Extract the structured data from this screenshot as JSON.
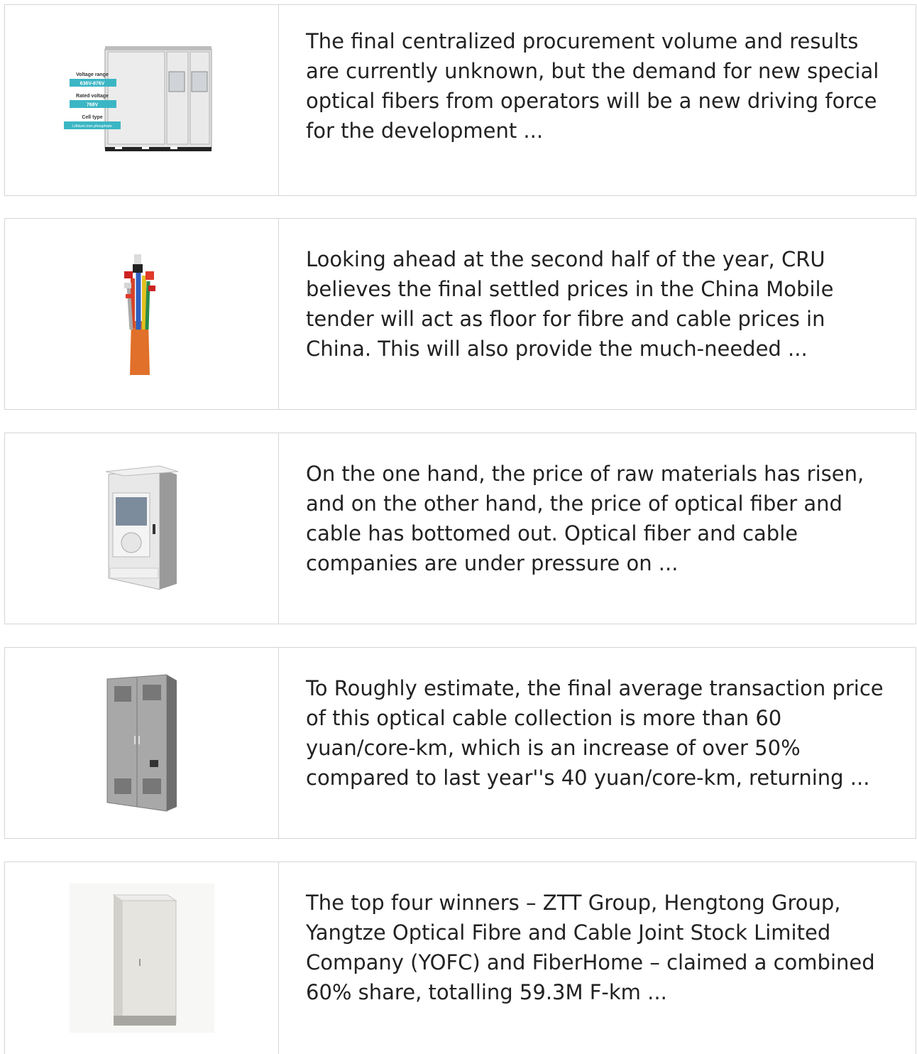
{
  "articles": [
    {
      "image_icon": "battery-cabinet-image",
      "image_labels": [
        "Voltage range",
        "636V-876V",
        "Rated voltage",
        "768V",
        "Cell type",
        "Lithium iron phosphate"
      ],
      "excerpt": "The final centralized procurement volume and results are currently unknown, but the demand for new special optical fibers from operators will be a new driving force for the development ..."
    },
    {
      "image_icon": "cable-bundle-image",
      "excerpt": "Looking ahead at the second half of the year, CRU believes the final settled prices in the China Mobile tender will act as floor for fibre and cable prices in China. This will also provide the much-needed ..."
    },
    {
      "image_icon": "outdoor-cabinet-with-ac-image",
      "excerpt": "On the one hand, the price of raw materials has risen, and on the other hand, the price of optical fiber and cable has bottomed out. Optical fiber and cable companies are under pressure on ..."
    },
    {
      "image_icon": "double-door-cabinet-image",
      "excerpt": "To Roughly estimate, the final average transaction price of this optical cable collection is more than 60 yuan/core-km, which is an increase of over 50% compared to last year''s 40 yuan/core-km, returning ..."
    },
    {
      "image_icon": "single-door-cabinet-image",
      "excerpt": "The top four winners – ZTT Group, Hengtong Group, Yangtze Optical Fibre and Cable Joint Stock Limited Company (YOFC) and FiberHome – claimed a combined 60% share, totalling 59.3M F-km ..."
    }
  ],
  "colors": {
    "border": "#d6d6d6",
    "text": "#222222",
    "label_teal": "#3bb6c4"
  }
}
